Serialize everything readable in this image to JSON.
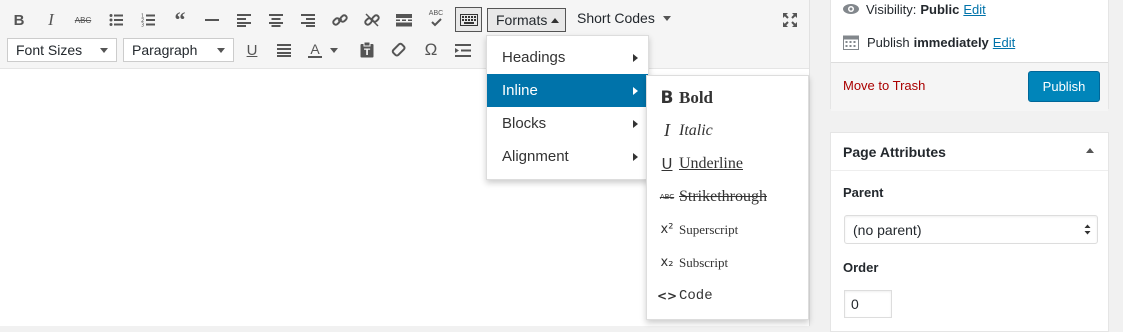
{
  "toolbar": {
    "row1_icons": [
      "bold-icon",
      "italic-icon",
      "strikethrough-icon",
      "bullet-list-icon",
      "numbered-list-icon",
      "blockquote-icon",
      "horizontal-rule-icon",
      "align-left-icon",
      "align-center-icon",
      "align-right-icon",
      "insert-link-icon",
      "remove-link-icon",
      "read-more-icon",
      "spellcheck-icon",
      "toolbar-toggle-icon"
    ],
    "formats_label": "Formats",
    "shortcodes_label": "Short Codes",
    "font_sizes_label": "Font Sizes",
    "paragraph_label": "Paragraph",
    "row2_icons": [
      "underline-icon",
      "justify-icon",
      "text-color-icon",
      "paste-text-icon",
      "clear-formatting-icon",
      "special-character-icon",
      "indent-icon"
    ]
  },
  "formats_menu": {
    "items": [
      {
        "label": "Headings"
      },
      {
        "label": "Inline"
      },
      {
        "label": "Blocks"
      },
      {
        "label": "Alignment"
      }
    ],
    "active_index": 1
  },
  "inline_submenu": {
    "items": [
      {
        "label": "Bold",
        "icon": "B",
        "icon_name": "bold-icon"
      },
      {
        "label": "Italic",
        "icon": "I",
        "icon_name": "italic-icon"
      },
      {
        "label": "Underline",
        "icon": "U",
        "icon_name": "underline-icon"
      },
      {
        "label": "Strikethrough",
        "icon": "ABC",
        "icon_name": "strikethrough-icon"
      },
      {
        "label": "Superscript",
        "icon": "x²",
        "icon_name": "superscript-icon"
      },
      {
        "label": "Subscript",
        "icon": "x₂",
        "icon_name": "subscript-icon"
      },
      {
        "label": "Code",
        "icon": "<>",
        "icon_name": "code-icon"
      }
    ]
  },
  "publish_box": {
    "visibility_label": "Visibility:",
    "visibility_value": "Public",
    "visibility_edit": "Edit",
    "publish_label": "Publish",
    "publish_value": "immediately",
    "publish_edit": "Edit",
    "trash_label": "Move to Trash",
    "publish_button": "Publish"
  },
  "page_attributes": {
    "title": "Page Attributes",
    "parent_label": "Parent",
    "parent_value": "(no parent)",
    "order_label": "Order",
    "order_value": "0"
  },
  "colors": {
    "accent": "#0073aa",
    "publish_button": "#0085ba",
    "trash": "#a00"
  }
}
